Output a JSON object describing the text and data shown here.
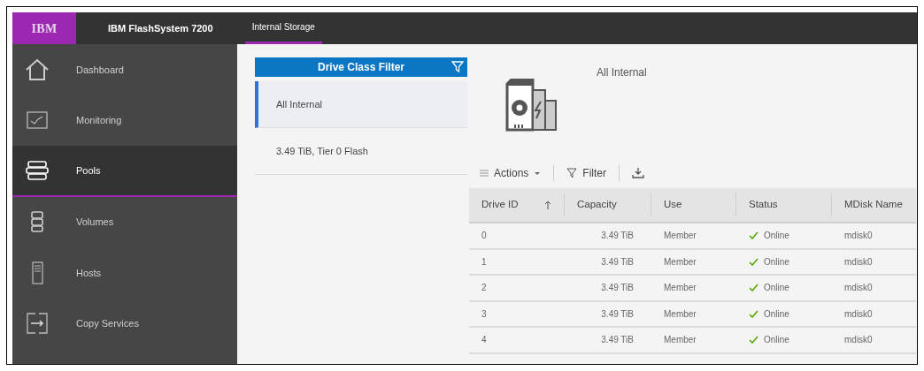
{
  "header": {
    "logo": "IBM",
    "product": "IBM FlashSystem 7200",
    "breadcrumb": "Internal Storage"
  },
  "sidebar": {
    "items": [
      {
        "label": "Dashboard",
        "selected": false
      },
      {
        "label": "Monitoring",
        "selected": false
      },
      {
        "label": "Pools",
        "selected": true
      },
      {
        "label": "Volumes",
        "selected": false
      },
      {
        "label": "Hosts",
        "selected": false
      },
      {
        "label": "Copy Services",
        "selected": false
      }
    ]
  },
  "drive_class_filter": {
    "title": "Drive Class Filter",
    "items": [
      {
        "label": "All Internal",
        "selected": true
      },
      {
        "label": "3.49 TiB, Tier 0 Flash",
        "selected": false
      }
    ]
  },
  "detail": {
    "title": "All Internal"
  },
  "toolbar": {
    "actions": "Actions",
    "filter": "Filter"
  },
  "table": {
    "columns": [
      {
        "label": "Drive ID",
        "sorted": true
      },
      {
        "label": "Capacity",
        "sorted": false
      },
      {
        "label": "Use",
        "sorted": false
      },
      {
        "label": "Status",
        "sorted": false
      },
      {
        "label": "MDisk Name",
        "sorted": false
      }
    ],
    "rows": [
      [
        "0",
        "3.49 TiB",
        "Member",
        "Online",
        "mdisk0"
      ],
      [
        "1",
        "3.49 TiB",
        "Member",
        "Online",
        "mdisk0"
      ],
      [
        "2",
        "3.49 TiB",
        "Member",
        "Online",
        "mdisk0"
      ],
      [
        "3",
        "3.49 TiB",
        "Member",
        "Online",
        "mdisk0"
      ],
      [
        "4",
        "3.49 TiB",
        "Member",
        "Online",
        "mdisk0"
      ]
    ]
  }
}
